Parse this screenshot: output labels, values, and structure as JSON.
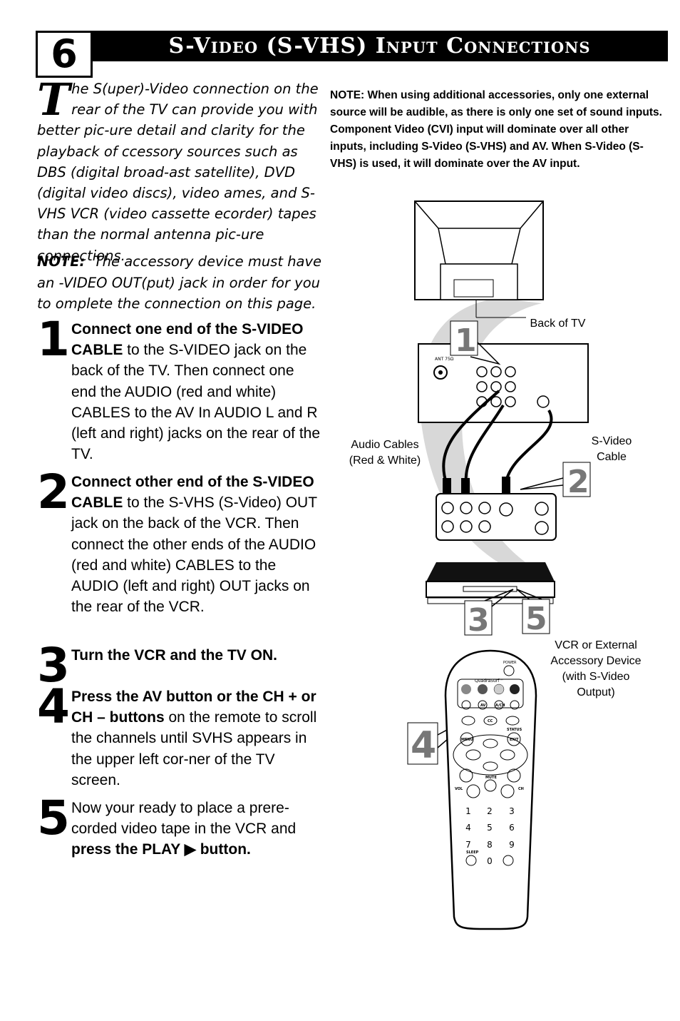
{
  "section_number": "6",
  "title": "S-Video (S-VHS) Input Connections",
  "intro": {
    "dropcap": "T",
    "text": "he S(uper)-Video connection on the rear of the TV can provide you with better pic-ure detail and clarity for the playback of ccessory sources such as DBS (digital broad-ast satellite), DVD (digital video discs), video ames, and S-VHS VCR (video cassette ecorder) tapes than the normal antenna pic-ure connections."
  },
  "note_left": {
    "label": "NOTE:",
    "text": "The accessory device must have an -VIDEO OUT(put) jack in order for you to omplete the connection on this page."
  },
  "note_right": "NOTE: When using additional accessories, only one external source will be audible, as there is only one set of sound inputs. Component Video (CVI) input will dominate over all other inputs, including S-Video (S-VHS) and AV. When S-Video (S-VHS) is used, it will dominate over the AV input.",
  "steps": [
    {
      "num": "1",
      "bold": "Connect one end of the S-VIDEO CABLE",
      "text": " to the S-VIDEO jack on the back of the TV. Then connect one end the AUDIO (red and white) CABLES to the AV In AUDIO L and R (left and right) jacks on the rear of the TV."
    },
    {
      "num": "2",
      "bold": "Connect other end of the S-VIDEO CABLE",
      "text": " to the S-VHS (S-Video) OUT jack on the back of the VCR. Then connect the other ends of the AUDIO (red and white) CABLES to the AUDIO (left and right) OUT jacks on the rear of the VCR."
    },
    {
      "num": "3",
      "bold": "Turn the VCR and the TV ON.",
      "text": ""
    },
    {
      "num": "4",
      "bold": "Press the AV button or the CH + or CH – buttons",
      "text": " on the remote to scroll the channels until SVHS appears in the upper left cor-ner of the TV screen."
    },
    {
      "num": "5",
      "text": "Now your ready to place a prere-corded video tape in the VCR and ",
      "bold": "press the PLAY ▶ button."
    }
  ],
  "diagram": {
    "labels": {
      "back_of_tv": "Back of TV",
      "audio_cables": "Audio Cables (Red & White)",
      "svideo_cable": "S-Video Cable",
      "vcr_device": "VCR or External Accessory Device (with S-Video Output)",
      "ant": "ANT 75Ω"
    },
    "callouts": [
      "1",
      "2",
      "3",
      "5",
      "4"
    ],
    "remote": {
      "power": "POWER",
      "quadrasurf": "QuadraSurf™",
      "av": "AV",
      "ach": "A/CH",
      "cc": "CC",
      "menu": "MENU",
      "exit": "EXIT",
      "status": "STATUS",
      "mute": "MUTE",
      "vol": "VOL",
      "ch": "CH",
      "sleep": "SLEEP",
      "digits": [
        "1",
        "2",
        "3",
        "4",
        "5",
        "6",
        "7",
        "8",
        "9",
        "0"
      ]
    },
    "colors": {
      "callout_gray": "#777777",
      "swoosh": "#d8d8d8"
    }
  }
}
